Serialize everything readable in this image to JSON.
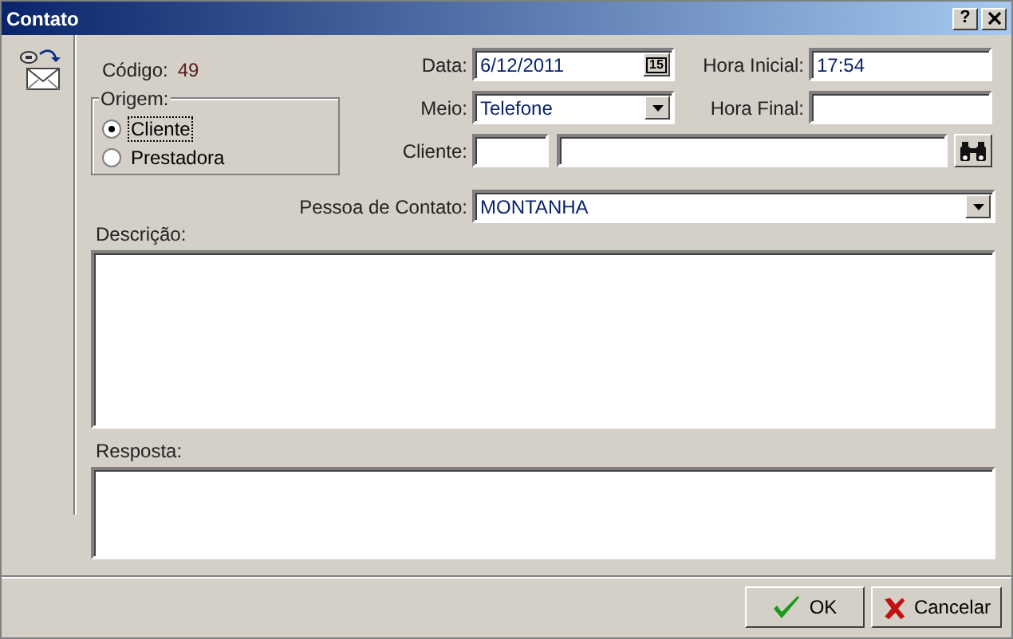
{
  "window": {
    "title": "Contato",
    "help_button": "?"
  },
  "codigo": {
    "label": "Código:",
    "value": "49"
  },
  "origem": {
    "legend": "Origem:",
    "options": [
      {
        "label": "Cliente",
        "selected": true
      },
      {
        "label": "Prestadora",
        "selected": false
      }
    ]
  },
  "data": {
    "label": "Data:",
    "value": "6/12/2011",
    "calendar": "15"
  },
  "hora_inicial": {
    "label": "Hora Inicial:",
    "value": "17:54"
  },
  "meio": {
    "label": "Meio:",
    "value": "Telefone"
  },
  "hora_final": {
    "label": "Hora Final:"
  },
  "cliente": {
    "label": "Cliente:"
  },
  "pessoa_de_contato": {
    "label": "Pessoa de Contato:",
    "value": "MONTANHA"
  },
  "descricao": {
    "label": "Descrição:"
  },
  "resposta": {
    "label": "Resposta:"
  },
  "buttons": [
    {
      "kind": "ok",
      "label": "OK"
    },
    {
      "kind": "cancel",
      "label": "Cancelar"
    }
  ]
}
